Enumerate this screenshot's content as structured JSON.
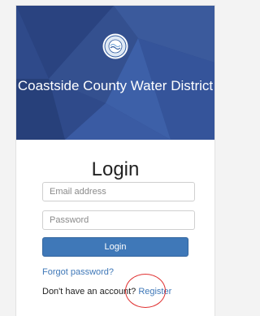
{
  "banner": {
    "organization": "Coastside County Water District",
    "logo_icon": "water-district-seal-icon",
    "color": "#2f4a8a"
  },
  "form": {
    "title": "Login",
    "email_placeholder": "Email address",
    "password_placeholder": "Password",
    "login_label": "Login",
    "forgot_label": "Forgot password?",
    "no_account_text": "Don't have an account?",
    "register_label": "Register"
  },
  "colors": {
    "accent": "#3f78b8",
    "annotation": "#e03030"
  }
}
